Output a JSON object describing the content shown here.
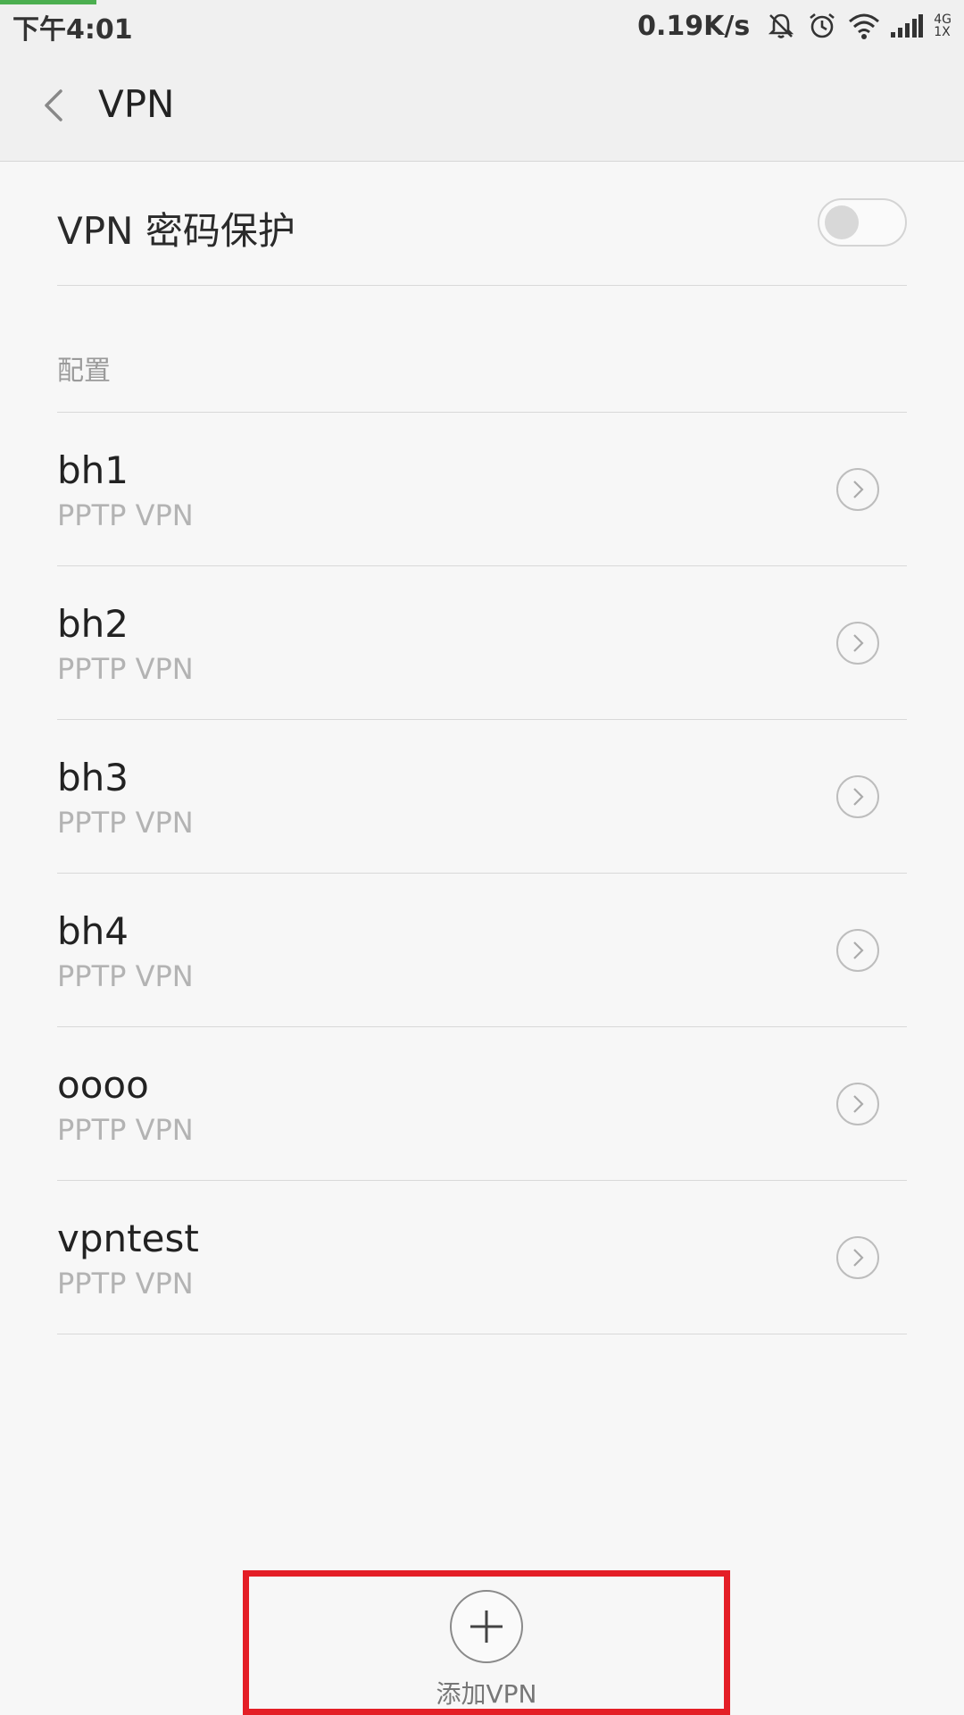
{
  "status_bar": {
    "time": "下午4:01",
    "speed": "0.19K/s",
    "network_top": "4G",
    "network_bottom": "1X",
    "icons": [
      "mute-icon",
      "alarm-icon",
      "wifi-icon",
      "signal-icon"
    ]
  },
  "header": {
    "title": "VPN",
    "back_icon": "chevron-left-icon"
  },
  "password_protection": {
    "label": "VPN 密码保护",
    "enabled": false
  },
  "section": {
    "label": "配置"
  },
  "vpn_list": [
    {
      "name": "bh1",
      "type": "PPTP VPN"
    },
    {
      "name": "bh2",
      "type": "PPTP VPN"
    },
    {
      "name": "bh3",
      "type": "PPTP VPN"
    },
    {
      "name": "bh4",
      "type": "PPTP VPN"
    },
    {
      "name": "oooo",
      "type": "PPTP VPN"
    },
    {
      "name": "vpntest",
      "type": "PPTP VPN"
    }
  ],
  "add_vpn": {
    "label": "添加VPN",
    "icon": "plus-icon",
    "highlight_color": "#e41e26"
  },
  "colors": {
    "background": "#f7f7f7",
    "progress": "#4caf50"
  }
}
